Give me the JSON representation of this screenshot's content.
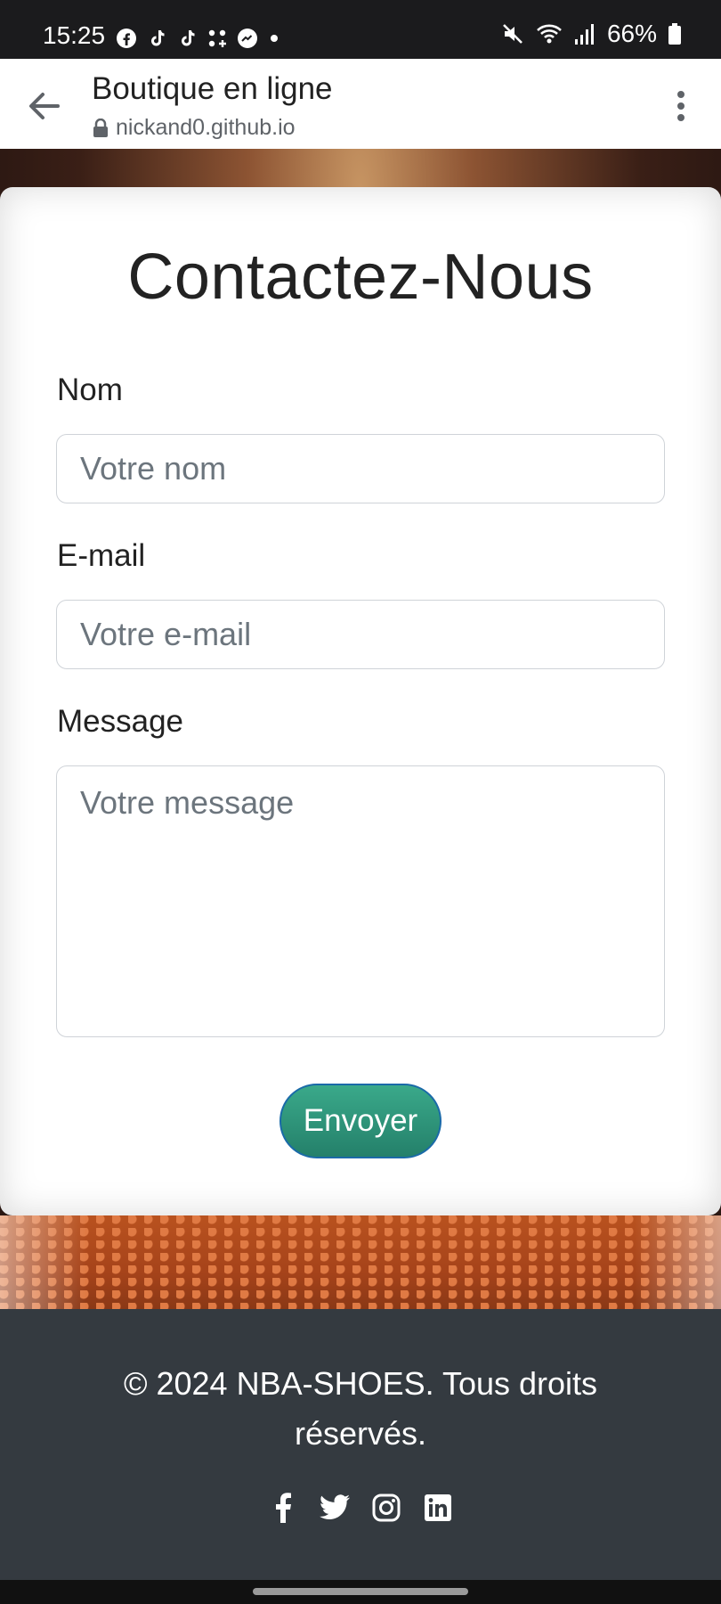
{
  "status_bar": {
    "time": "15:25",
    "battery": "66%",
    "app_icons": [
      "facebook-icon",
      "tiktok-icon",
      "tiktok-icon",
      "app-grid-icon",
      "messenger-icon"
    ]
  },
  "browser": {
    "title": "Boutique en ligne",
    "url": "nickand0.github.io"
  },
  "contact": {
    "title": "Contactez-Nous",
    "name_label": "Nom",
    "name_placeholder": "Votre nom",
    "email_label": "E-mail",
    "email_placeholder": "Votre e-mail",
    "message_label": "Message",
    "message_placeholder": "Votre message",
    "submit_label": "Envoyer"
  },
  "footer": {
    "text": "© 2024 NBA-SHOES. Tous droits réservés.",
    "social": [
      "facebook-icon",
      "twitter-icon",
      "instagram-icon",
      "linkedin-icon"
    ]
  },
  "colors": {
    "footer_bg": "#343a40",
    "button_accent": "#24806a",
    "button_border": "#1a6aa8"
  }
}
